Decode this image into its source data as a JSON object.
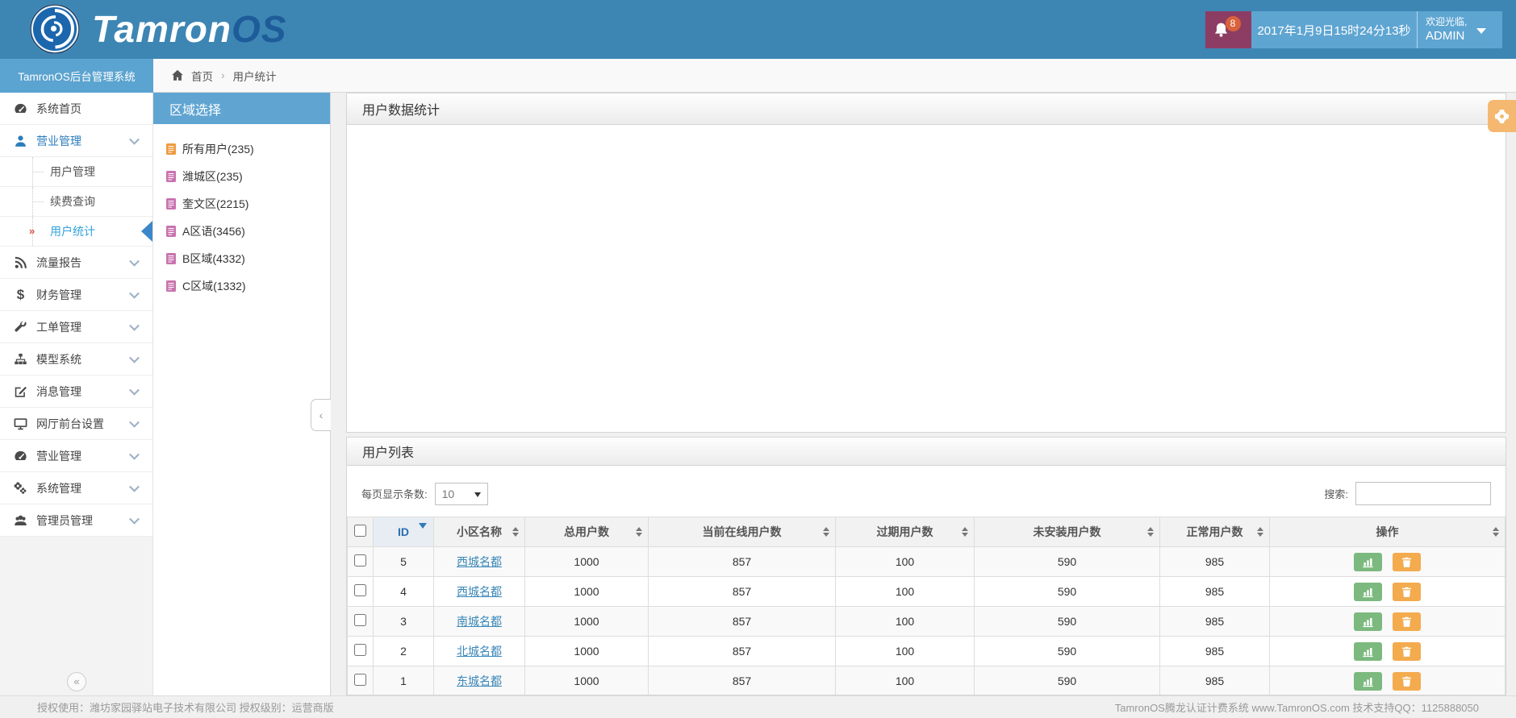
{
  "header": {
    "brand_main": "Tamron",
    "brand_suffix": "OS",
    "notification_count": "8",
    "datetime": "2017年1月9日15时24分13秒",
    "welcome": "欢迎光临,",
    "username": "ADMIN"
  },
  "subheader": {
    "system_title": "TamronOS后台管理系统",
    "breadcrumb_home": "首页",
    "breadcrumb_sep": "›",
    "breadcrumb_current": "用户统计"
  },
  "sidebar": {
    "collapse_glyph": "«",
    "items": [
      {
        "label": "系统首页"
      },
      {
        "label": "营业管理"
      },
      {
        "label": "用户管理"
      },
      {
        "label": "续费查询"
      },
      {
        "label": "用户统计"
      },
      {
        "label": "流量报告"
      },
      {
        "label": "财务管理"
      },
      {
        "label": "工单管理"
      },
      {
        "label": "模型系统"
      },
      {
        "label": "消息管理"
      },
      {
        "label": "网厅前台设置"
      },
      {
        "label": "营业管理"
      },
      {
        "label": "系统管理"
      },
      {
        "label": "管理员管理"
      }
    ]
  },
  "region_panel": {
    "title": "区域选择",
    "collapse_glyph": "‹",
    "items": [
      {
        "label": "所有用户(235)"
      },
      {
        "label": "潍城区(235)"
      },
      {
        "label": "奎文区(2215)"
      },
      {
        "label": "A区语(3456)"
      },
      {
        "label": "B区域(4332)"
      },
      {
        "label": "C区域(1332)"
      }
    ]
  },
  "stats_panel": {
    "title": "用户数据统计"
  },
  "list_panel": {
    "title": "用户列表",
    "page_size_label": "每页显示条数:",
    "page_size_value": "10",
    "search_label": "搜索:",
    "columns": [
      "ID",
      "小区名称",
      "总用户数",
      "当前在线用户数",
      "过期用户数",
      "未安装用户数",
      "正常用户数",
      "操作"
    ],
    "rows": [
      {
        "id": "5",
        "name": "西城名都",
        "total": "1000",
        "online": "857",
        "expired": "100",
        "uninstalled": "590",
        "normal": "985"
      },
      {
        "id": "4",
        "name": "西城名都",
        "total": "1000",
        "online": "857",
        "expired": "100",
        "uninstalled": "590",
        "normal": "985"
      },
      {
        "id": "3",
        "name": "南城名都",
        "total": "1000",
        "online": "857",
        "expired": "100",
        "uninstalled": "590",
        "normal": "985"
      },
      {
        "id": "2",
        "name": "北城名都",
        "total": "1000",
        "online": "857",
        "expired": "100",
        "uninstalled": "590",
        "normal": "985"
      },
      {
        "id": "1",
        "name": "东城名都",
        "total": "1000",
        "online": "857",
        "expired": "100",
        "uninstalled": "590",
        "normal": "985"
      }
    ]
  },
  "footer": {
    "left": "授权使用：潍坊家园驿站电子技术有限公司  授权级别：运营商版",
    "right": "TamronOS腾龙认证计费系统 www.TamronOS.com 技术支持QQ：1125888050"
  },
  "colors": {
    "header_blue": "#3d86b4",
    "light_blue": "#5fa5d2",
    "bell_purple": "#8d3d63",
    "badge_orange": "#d9623c",
    "active_link_blue": "#31a3dc",
    "table_link_blue": "#3a87b7",
    "chart_btn_green": "#7cb97e",
    "delete_btn_orange": "#f3ab4e",
    "flyout_gear_orange": "#f5b871"
  }
}
